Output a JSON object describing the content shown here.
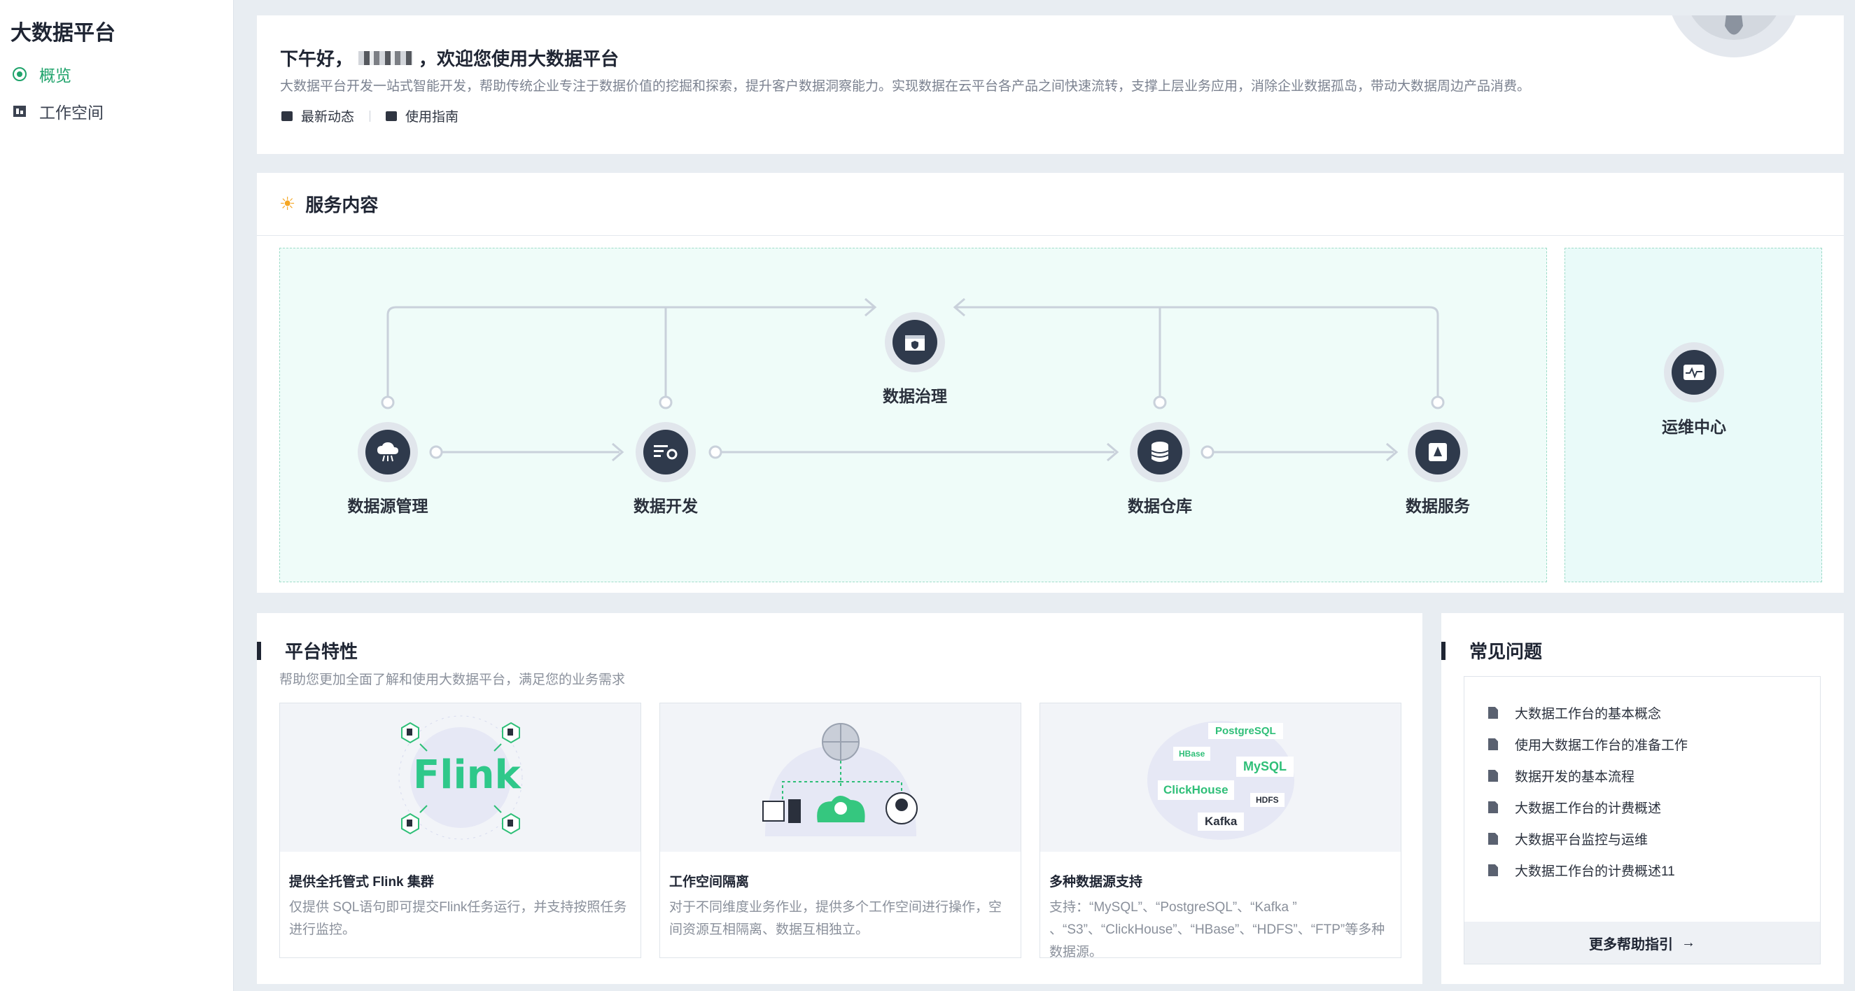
{
  "sidebar": {
    "title": "大数据平台",
    "items": [
      {
        "label": "概览",
        "icon": "overview-icon",
        "active": true
      },
      {
        "label": "工作空间",
        "icon": "workspace-icon",
        "active": false
      }
    ]
  },
  "welcome": {
    "greeting_prefix": "下午好，",
    "greeting_suffix": "，欢迎您使用大数据平台",
    "description": "大数据平台开发一站式智能开发，帮助传统企业专注于数据价值的挖掘和探索，提升客户数据洞察能力。实现数据在云平台各产品之间快速流转，支撑上层业务应用，消除企业数据孤岛，带动大数据周边产品消费。",
    "links": [
      "最新动态",
      "使用指南"
    ]
  },
  "service": {
    "title": "服务内容",
    "nodes": {
      "source": "数据源管理",
      "develop": "数据开发",
      "governance": "数据治理",
      "warehouse": "数据仓库",
      "dataservice": "数据服务",
      "ops": "运维中心"
    }
  },
  "features": {
    "title": "平台特性",
    "subtitle": "帮助您更加全面了解和使用大数据平台，满足您的业务需求",
    "cards": [
      {
        "title": "提供全托管式 Flink 集群",
        "desc": "仅提供 SQL语句即可提交Flink任务运行，并支持按照任务进行监控。",
        "image_text": "Flink"
      },
      {
        "title": "工作空间隔离",
        "desc": "对于不同维度业务作业，提供多个工作空间进行操作，空间资源互相隔离、数据互相独立。"
      },
      {
        "title": "多种数据源支持",
        "desc": "支持：“MySQL”、“PostgreSQL”、“Kafka ” 、“S3”、“ClickHouse”、“HBase”、“HDFS”、“FTP”等多种数据源。",
        "tags": [
          "PostgreSQL",
          "HBase",
          "MySQL",
          "ClickHouse",
          "HDFS",
          "Kafka"
        ]
      }
    ]
  },
  "faq": {
    "title": "常见问题",
    "items": [
      "大数据工作台的基本概念",
      "使用大数据工作台的准备工作",
      "数据开发的基本流程",
      "大数据工作台的计费概述",
      "大数据平台监控与运维",
      "大数据工作台的计费概述11"
    ],
    "more": "更多帮助指引",
    "more_arrow": "→"
  },
  "colors": {
    "accent": "#1fa36b",
    "node_dark": "#2f3a4c",
    "flow_bg": "#effcf9",
    "flow_border": "#9fdcc9"
  }
}
